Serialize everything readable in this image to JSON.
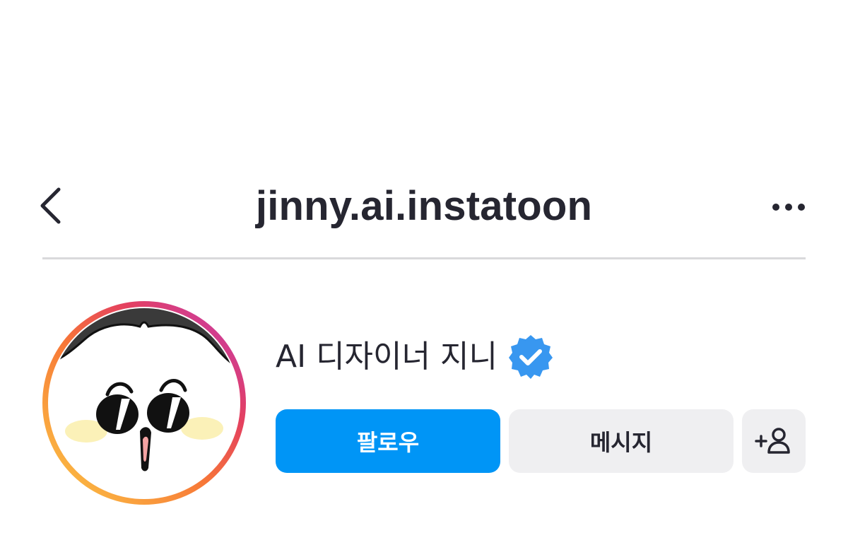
{
  "header": {
    "username": "jinny.ai.instatoon",
    "back_icon": "chevron-left-icon",
    "more_icon": "more-horizontal-icon"
  },
  "profile": {
    "display_name": "AI 디자이너 지니",
    "verified": true,
    "verified_color": "#3897f0",
    "avatar_ring_colors": [
      "#c13ab7",
      "#e4405f",
      "#f77737",
      "#fcca45"
    ]
  },
  "actions": {
    "follow_label": "팔로우",
    "message_label": "메시지",
    "add_user_icon": "add-user-icon",
    "follow_color": "#0095f6"
  }
}
